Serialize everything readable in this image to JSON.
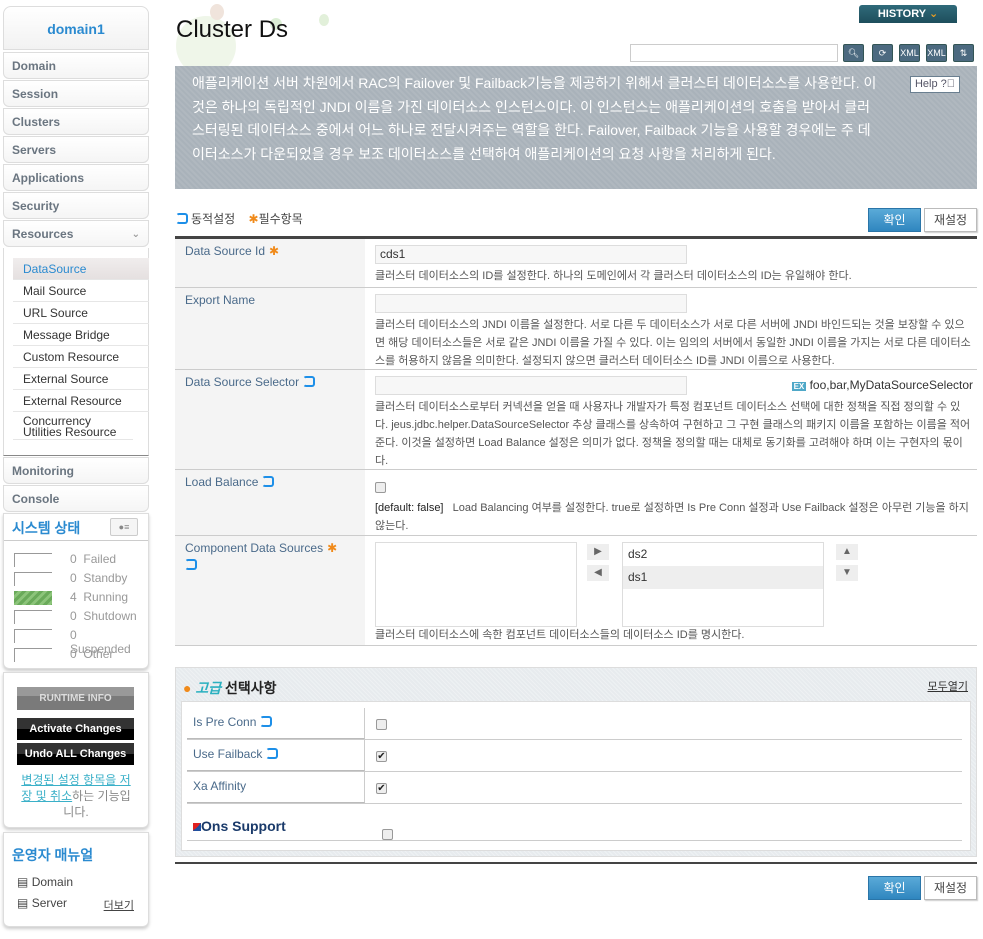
{
  "sidebar": {
    "domain": "domain1",
    "items": [
      "Domain",
      "Session",
      "Clusters",
      "Servers",
      "Applications",
      "Security",
      "Resources"
    ],
    "resources_sub": [
      "DataSource",
      "Mail Source",
      "URL Source",
      "Message Bridge",
      "Custom Resource",
      "External Source",
      "External Resource",
      "Concurrency Utilities Resource"
    ],
    "active_sub": "DataSource",
    "items_after": [
      "Monitoring",
      "Console"
    ],
    "system_status": {
      "title": "시스템 상태",
      "rows": [
        {
          "count": "0",
          "label": "Failed"
        },
        {
          "count": "0",
          "label": "Standby"
        },
        {
          "count": "4",
          "label": "Running"
        },
        {
          "count": "0",
          "label": "Shutdown"
        },
        {
          "count": "0",
          "label": "Suspended"
        },
        {
          "count": "0",
          "label": "Other"
        }
      ]
    },
    "runtime_info": "RUNTIME INFO",
    "activate_changes": "Activate Changes",
    "undo_changes": "Undo ALL Changes",
    "changes_note_link": "변경된 설정 항목을 저장 및 취소",
    "changes_note_rest": "하는 기능입니다.",
    "manual": {
      "title": "운영자 매뉴얼",
      "links": [
        "Domain",
        "Server"
      ],
      "more": "더보기"
    }
  },
  "header": {
    "title": "Cluster Ds",
    "history": "HISTORY",
    "search_value": "",
    "help": "Help"
  },
  "description": "애플리케이션 서버 차원에서 RAC의 Failover 및 Failback기능을 제공하기 위해서 클러스터 데이터소스를 사용한다. 이것은 하나의 독립적인 JNDI 이름을 가진 데이터소스 인스턴스이다. 이 인스턴스는 애플리케이션의 호출을 받아서 클러스터링된 데이터소스 중에서 어느 하나로 전달시켜주는 역할을 한다. Failover, Failback 기능을 사용할 경우에는 주 데이터소스가 다운되었을 경우 보조 데이터소스를 선택하여 애플리케이션의 요청 사항을 처리하게 된다.",
  "legend": {
    "dynamic": "동적설정",
    "required": "필수항목"
  },
  "buttons": {
    "ok": "확인",
    "reset": "재설정"
  },
  "fields": {
    "ds_id": {
      "label": "Data Source Id",
      "value": "cds1",
      "help": "클러스터 데이터소스의 ID를 설정한다. 하나의 도메인에서 각 클러스터 데이터소스의 ID는 유일해야 한다."
    },
    "export_name": {
      "label": "Export Name",
      "value": "",
      "help": "클러스터 데이터소스의 JNDI 이름을 설정한다. 서로 다른 두 데이터소스가 서로 다른 서버에 JNDI 바인드되는 것을 보장할 수 있으면 해당 데이터소스들은 서로 같은 JNDI 이름을 가질 수 있다. 이는 임의의 서버에서 동일한 JNDI 이름을 가지는 서로 다른 데이터소스를 허용하지 않음을 의미한다. 설정되지 않으면 클러스터 데이터소스 ID를 JNDI 이름으로 사용한다."
    },
    "selector": {
      "label": "Data Source Selector",
      "value": "",
      "example_badge": "EX",
      "example": "foo,bar,MyDataSourceSelector",
      "help": "클러스터 데이터소스로부터 커넥션을 얻을 때 사용자나 개발자가 특정 컴포넌트 데이터소스 선택에 대한 정책을 직접 정의할 수 있다. jeus.jdbc.helper.DataSourceSelector 추상 클래스를 상속하여 구현하고 그 구현 클래스의 패키지 이름을 포함하는 이름을 적어준다. 이것을 설정하면 Load Balance 설정은 의미가 없다. 정책을 정의할 때는 대체로 동기화를 고려해야 하며 이는 구현자의 몫이다."
    },
    "load_balance": {
      "label": "Load Balance",
      "checked": false,
      "default": "[default: false]",
      "help": "Load Balancing 여부를 설정한다. true로 설정하면 Is Pre Conn 설정과 Use Failback 설정은 아무런 기능을 하지 않는다."
    },
    "components": {
      "label": "Component Data Sources",
      "available": [],
      "selected": [
        "ds2",
        "ds1"
      ],
      "highlighted": "ds1",
      "help": "클러스터 데이터소스에 속한 컴포넌트 데이터소스들의 데이터소스 ID를 명시한다."
    }
  },
  "advanced": {
    "title_accent": "고급",
    "title": "선택사항",
    "expand_all": "모두열기",
    "rows": [
      {
        "label": "Is Pre Conn",
        "checked": false
      },
      {
        "label": "Use Failback",
        "checked": true
      },
      {
        "label": "Xa Affinity",
        "checked": true
      }
    ],
    "ons_support": {
      "label": "Ons Support",
      "checked": false
    }
  },
  "colors": {
    "accent": "#2a8ad0",
    "ok_button": "#3a92c8",
    "desc_bg": "#a9b2ba"
  }
}
